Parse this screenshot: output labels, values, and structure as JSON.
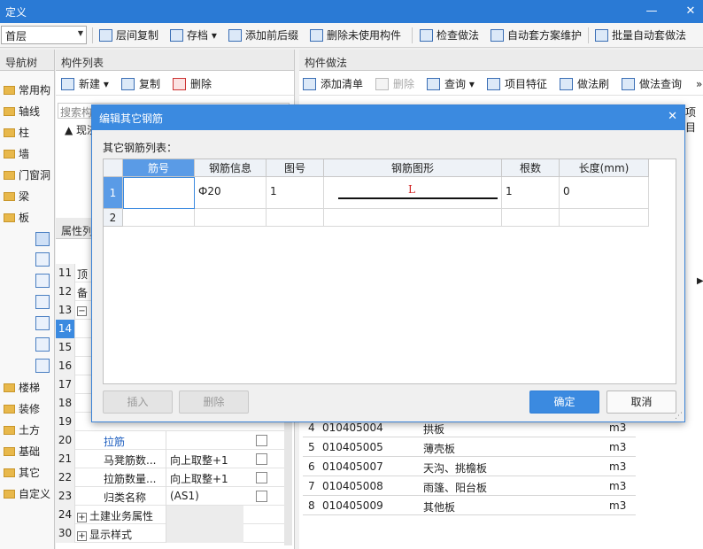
{
  "window": {
    "title": "定义"
  },
  "toolbar": {
    "floor": "首层",
    "items": [
      "层间复制",
      "存档",
      "添加前后缀",
      "删除未使用构件",
      "检查做法",
      "自动套方案维护",
      "批量自动套做法"
    ]
  },
  "nav": {
    "title": "导航树",
    "items": [
      "常用构",
      "轴线",
      "柱",
      "墙",
      "门窗洞",
      "梁",
      "板",
      "楼梯",
      "装修",
      "土方",
      "基础",
      "其它",
      "自定义"
    ]
  },
  "complist": {
    "title": "构件列表",
    "buttons": {
      "new": "新建",
      "copy": "复制",
      "delete": "删除"
    },
    "search_placeholder": "搜索构",
    "tree": "现浇"
  },
  "props": {
    "title": "属性列",
    "rows": [
      {
        "num": "11",
        "name": "顶",
        "value": ""
      },
      {
        "num": "12",
        "name": "备",
        "value": ""
      },
      {
        "num": "13",
        "name": "",
        "value": ""
      },
      {
        "num": "14",
        "name": "",
        "value": ""
      },
      {
        "num": "15",
        "name": "",
        "value": ""
      },
      {
        "num": "16",
        "name": "",
        "value": ""
      },
      {
        "num": "17",
        "name": "",
        "value": ""
      },
      {
        "num": "18",
        "name": "",
        "value": ""
      },
      {
        "num": "19",
        "name": "",
        "value": ""
      },
      {
        "num": "20",
        "name": "拉筋",
        "value": ""
      },
      {
        "num": "21",
        "name": "马凳筋数...",
        "value": "向上取整+1"
      },
      {
        "num": "22",
        "name": "拉筋数量...",
        "value": "向上取整+1"
      },
      {
        "num": "23",
        "name": "归类名称",
        "value": "(AS1)"
      },
      {
        "num": "24",
        "name": "土建业务属性",
        "value": ""
      },
      {
        "num": "30",
        "name": "显示样式",
        "value": ""
      }
    ]
  },
  "method": {
    "title": "构件做法",
    "buttons": {
      "add": "添加清单",
      "delete": "删除",
      "query": "查询",
      "feature": "项目特征",
      "brush": "做法刷",
      "search": "做法查询"
    },
    "col_label": "项目",
    "rows": [
      {
        "num": "4",
        "code": "010405004",
        "name": "拱板",
        "unit": "m3"
      },
      {
        "num": "5",
        "code": "010405005",
        "name": "薄壳板",
        "unit": "m3"
      },
      {
        "num": "6",
        "code": "010405007",
        "name": "天沟、挑檐板",
        "unit": "m3"
      },
      {
        "num": "7",
        "code": "010405008",
        "name": "雨篷、阳台板",
        "unit": "m3"
      },
      {
        "num": "8",
        "code": "010405009",
        "name": "其他板",
        "unit": "m3"
      }
    ]
  },
  "dialog": {
    "title": "编辑其它钢筋",
    "list_label": "其它钢筋列表：",
    "columns": [
      "筋号",
      "钢筋信息",
      "图号",
      "钢筋图形",
      "根数",
      "长度(mm)"
    ],
    "rows": [
      {
        "num": "1",
        "bar_no": "",
        "info": "Ф20",
        "fig_no": "1",
        "shape": "L",
        "count": "1",
        "length": "0"
      },
      {
        "num": "2",
        "bar_no": "",
        "info": "",
        "fig_no": "",
        "shape": "",
        "count": "",
        "length": ""
      }
    ],
    "buttons": {
      "insert": "插入",
      "delete": "删除",
      "ok": "确定",
      "cancel": "取消"
    }
  }
}
